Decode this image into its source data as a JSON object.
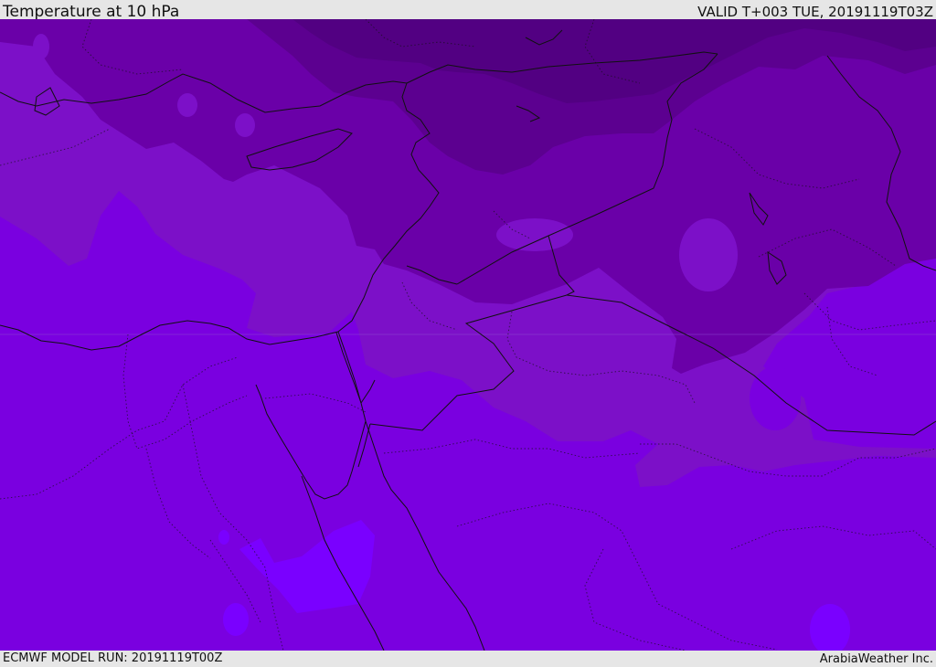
{
  "header": {
    "title": "Temperature at 10 hPa",
    "valid": "VALID T+003 TUE, 20191119T03Z"
  },
  "footer": {
    "model_run": "ECMWF MODEL RUN: 20191119T00Z",
    "brand": "ArabiaWeather Inc."
  },
  "map": {
    "field": "temperature",
    "level": "10 hPa",
    "colors": {
      "warmest": "#7a00e0",
      "warm": "#7c10c8",
      "mid": "#6a00a8",
      "cold": "#5c0090",
      "coldest": "#520082",
      "pocket": "#7a00ff",
      "border": "#111111"
    }
  }
}
